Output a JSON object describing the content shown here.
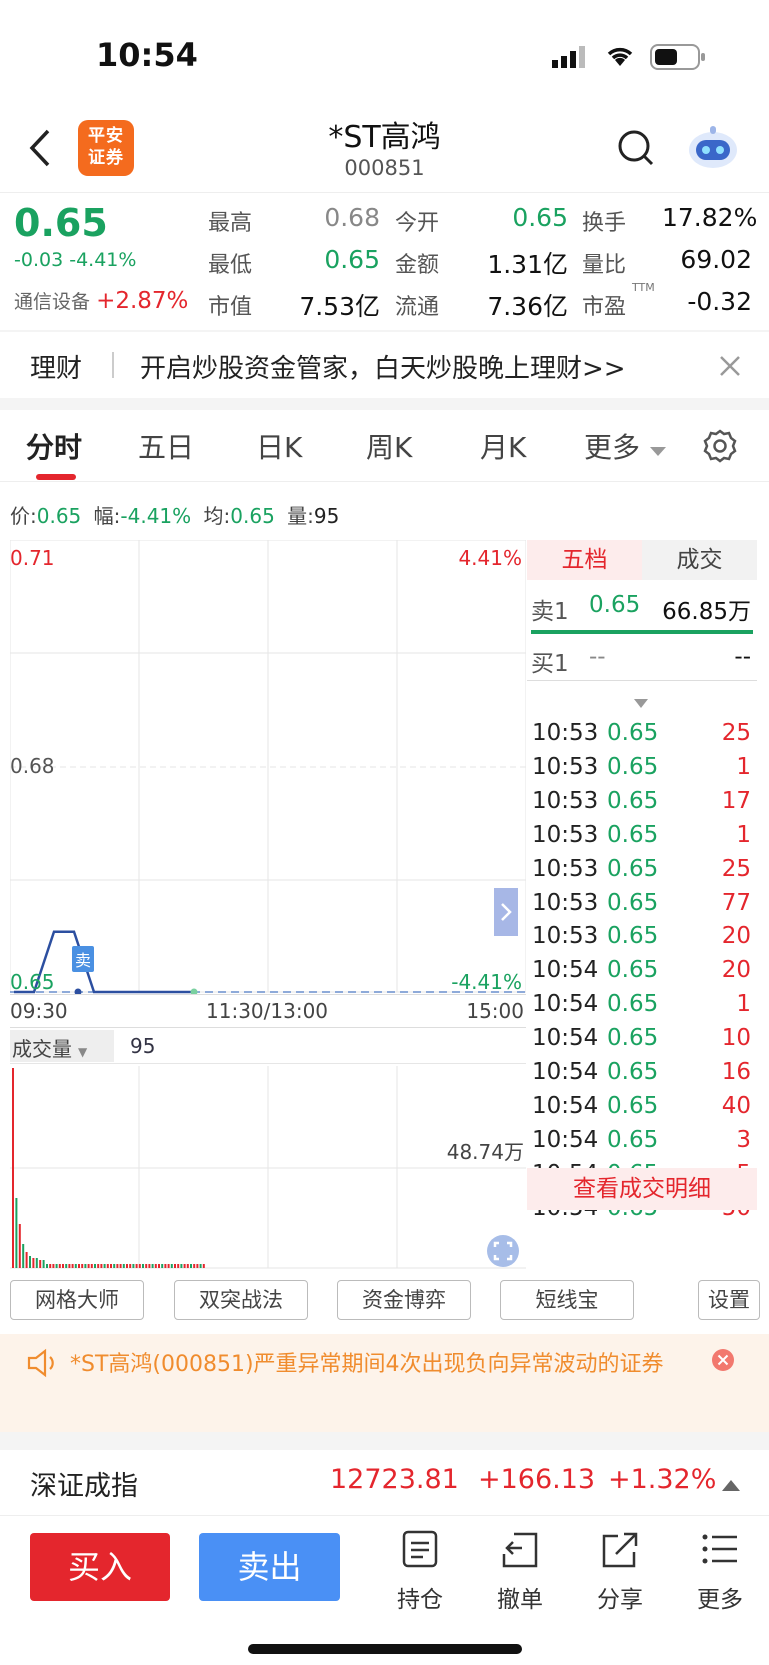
{
  "status_bar": {
    "time": "10:54"
  },
  "header": {
    "logo_line1": "平安",
    "logo_line2": "证券",
    "name": "*ST高鸿",
    "code": "000851"
  },
  "quote": {
    "price": "0.65",
    "change": "-0.03",
    "change_pct": "-4.41%",
    "sector": "通信设备",
    "sector_pct": "+2.87%",
    "labels": {
      "high": "最高",
      "low": "最低",
      "mktcap": "市值",
      "open": "今开",
      "amount": "金额",
      "float": "流通",
      "turnover": "换手",
      "vol_ratio": "量比",
      "pe": "市盈",
      "pe_sup": "TTM"
    },
    "high": "0.68",
    "low": "0.65",
    "mktcap": "7.53亿",
    "open": "0.65",
    "amount": "1.31亿",
    "float": "7.36亿",
    "turnover": "17.82%",
    "vol_ratio": "69.02",
    "pe": "-0.32"
  },
  "banner": {
    "tag": "理财",
    "text": "开启炒股资金管家，白天炒股晚上理财>>"
  },
  "tabs": [
    "分时",
    "五日",
    "日K",
    "周K",
    "月K",
    "更多"
  ],
  "info_line": {
    "price_label": "价:",
    "price": "0.65",
    "amp_label": "幅:",
    "amp": "-4.41%",
    "avg_label": "均:",
    "avg": "0.65",
    "vol_label": "量:",
    "vol": "95"
  },
  "chart": {
    "y_top": "0.71",
    "y_mid": "0.68",
    "y_bot": "0.65",
    "pct_top": "4.41%",
    "pct_bot": "-4.41%",
    "x_start": "09:30",
    "x_mid": "11:30/13:00",
    "x_end": "15:00",
    "sell_marker": "卖",
    "vol_label": "成交量",
    "vol_value": "95",
    "vol_max": "48.74万"
  },
  "chart_data": {
    "type": "line",
    "title": "",
    "xlabel": "",
    "ylabel": "",
    "x_ticks": [
      "09:30",
      "11:30/13:00",
      "15:00"
    ],
    "ylim": [
      0.65,
      0.71
    ],
    "series": [
      {
        "values": [
          0.65,
          0.65,
          0.658,
          0.658,
          0.65,
          0.65,
          0.65,
          0.65,
          0.65,
          0.65
        ]
      }
    ],
    "volume": {
      "max_label": "48.74万",
      "values": [
        1.0,
        0.35,
        0.22,
        0.12,
        0.08,
        0.06,
        0.05,
        0.05,
        0.04,
        0.04
      ]
    }
  },
  "side_panel": {
    "tab_active": "五档",
    "tab_other": "成交",
    "sell1_label": "卖1",
    "sell1_price": "0.65",
    "sell1_vol": "66.85万",
    "buy1_label": "买1",
    "buy1_price": "--",
    "buy1_vol": "--",
    "trades": [
      {
        "t": "10:53",
        "p": "0.65",
        "v": "25"
      },
      {
        "t": "10:53",
        "p": "0.65",
        "v": "1"
      },
      {
        "t": "10:53",
        "p": "0.65",
        "v": "17"
      },
      {
        "t": "10:53",
        "p": "0.65",
        "v": "1"
      },
      {
        "t": "10:53",
        "p": "0.65",
        "v": "25"
      },
      {
        "t": "10:53",
        "p": "0.65",
        "v": "77"
      },
      {
        "t": "10:53",
        "p": "0.65",
        "v": "20"
      },
      {
        "t": "10:54",
        "p": "0.65",
        "v": "20"
      },
      {
        "t": "10:54",
        "p": "0.65",
        "v": "1"
      },
      {
        "t": "10:54",
        "p": "0.65",
        "v": "10"
      },
      {
        "t": "10:54",
        "p": "0.65",
        "v": "16"
      },
      {
        "t": "10:54",
        "p": "0.65",
        "v": "40"
      },
      {
        "t": "10:54",
        "p": "0.65",
        "v": "3"
      },
      {
        "t": "10:54",
        "p": "0.65",
        "v": "5"
      },
      {
        "t": "10:54",
        "p": "0.65",
        "v": "50"
      }
    ],
    "detail_link": "查看成交明细"
  },
  "tools": [
    "网格大师",
    "双突战法",
    "资金博弈",
    "短线宝",
    "设置"
  ],
  "notice": {
    "text": "*ST高鸿(000851)严重异常期间4次出现负向异常波动的证券"
  },
  "index_bar": {
    "name": "深证成指",
    "value": "12723.81",
    "change": "+166.13",
    "pct": "+1.32%"
  },
  "bottom": {
    "buy": "买入",
    "sell": "卖出",
    "hold": "持仓",
    "cancel": "撤单",
    "share": "分享",
    "more": "更多"
  },
  "colors": {
    "red": "#e4262d",
    "green": "#1aa260",
    "blue": "#4a90f5",
    "orange": "#f08c2e"
  }
}
